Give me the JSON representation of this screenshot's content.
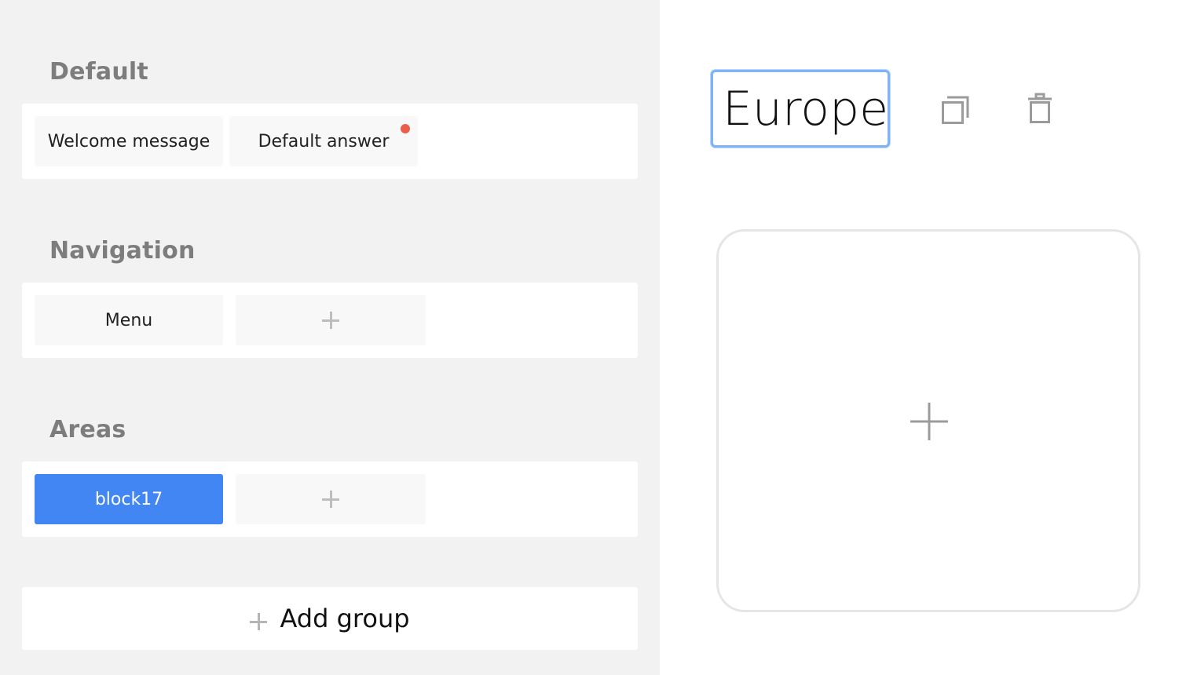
{
  "groups": [
    {
      "title": "Default",
      "blocks": [
        {
          "label": "Welcome message"
        },
        {
          "label": "Default answer"
        }
      ]
    },
    {
      "title": "Navigation",
      "blocks": [
        {
          "label": "Menu"
        }
      ]
    },
    {
      "title": "Areas",
      "blocks": [
        {
          "label": "block17"
        }
      ]
    }
  ],
  "add_group_label": "Add group",
  "editor": {
    "block_name_value": "Europe"
  },
  "icons": {
    "copy": "copy-icon",
    "delete": "trash-icon",
    "add": "plus-icon",
    "notification": "red-dot"
  },
  "colors": {
    "accent": "#4286f4",
    "notification_dot": "#e8604a",
    "panel_bg": "#f2f2f2",
    "group_title": "#7d7d7d"
  }
}
